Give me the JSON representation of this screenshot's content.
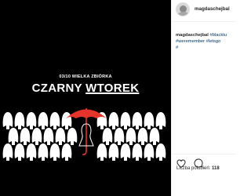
{
  "post": {
    "subtitle": "03/10 WIELKA ZBIÓRKA",
    "title_part1": "CZARNY ",
    "title_part2": "WTOREK",
    "colors": {
      "background": "#000000",
      "umbrella": "#e5342b",
      "figure": "#ffffff"
    }
  },
  "sidebar": {
    "username": "magdaschejbal",
    "caption_user": "magdaschejbal",
    "hashtags": [
      "#blacktu",
      "#weremember",
      "#letsgo",
      "#"
    ],
    "likes_label": "Liczba polubień:",
    "likes_count": "118"
  }
}
